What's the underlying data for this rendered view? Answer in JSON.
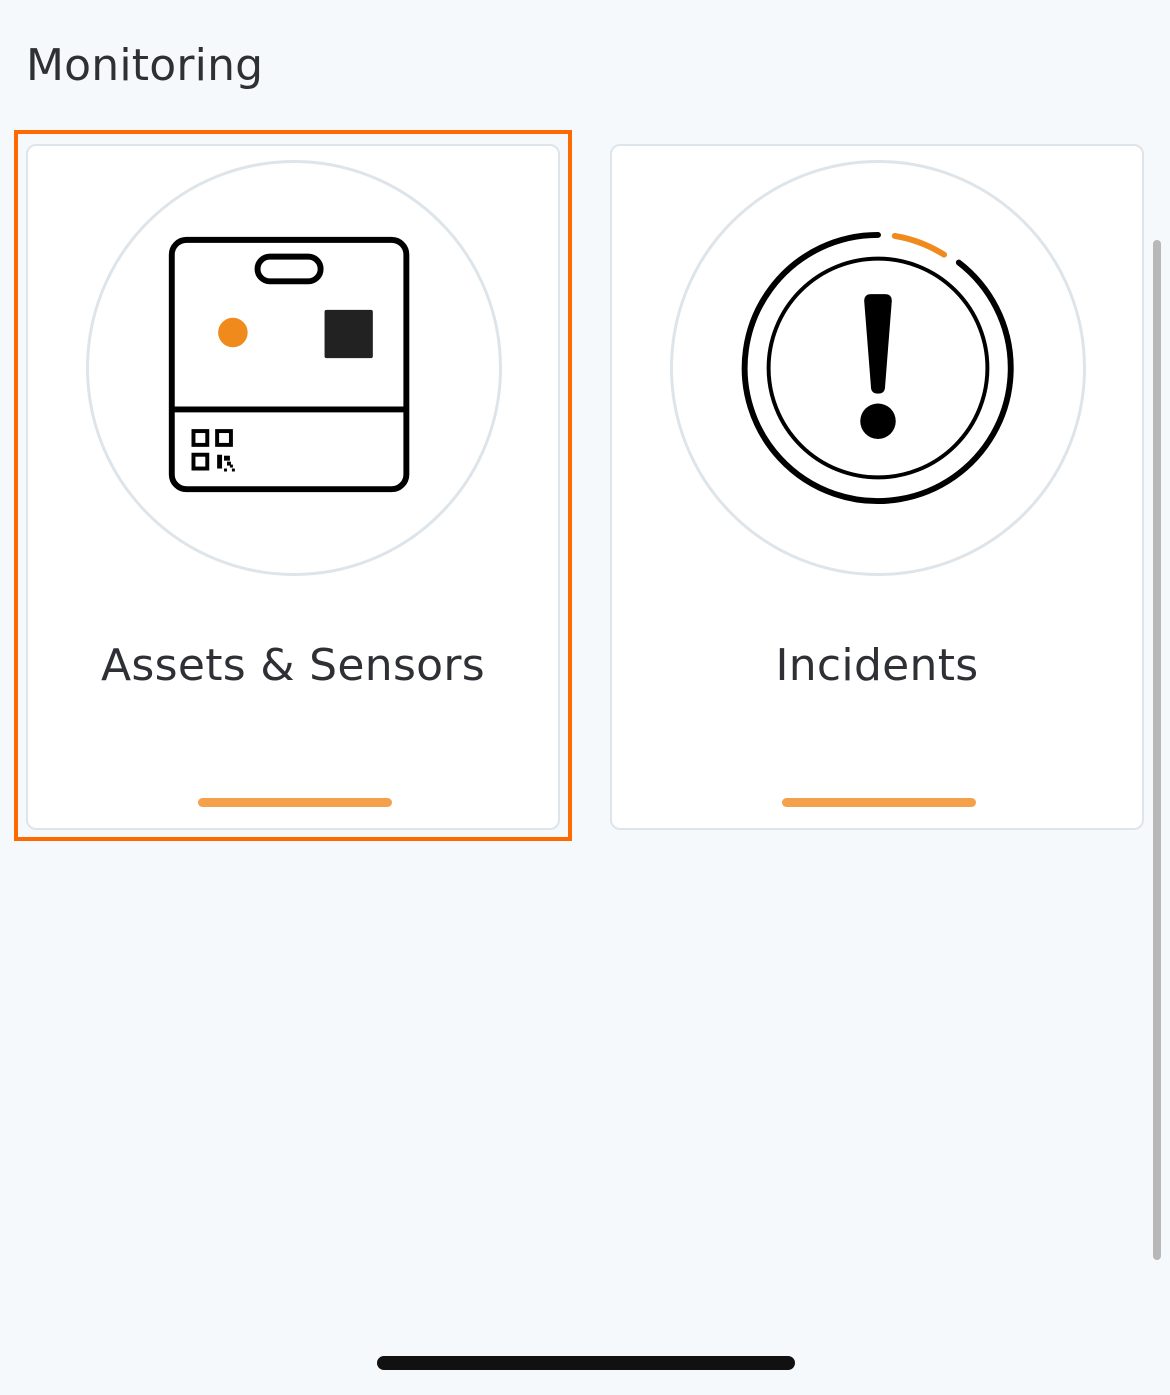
{
  "page": {
    "section_title": "Monitoring"
  },
  "tiles": [
    {
      "label": "Assets & Sensors",
      "icon": "asset-sensor-icon",
      "selected": true
    },
    {
      "label": "Incidents",
      "icon": "incident-alert-icon",
      "selected": false
    }
  ],
  "colors": {
    "background": "#f6f9fc",
    "tile_background": "#ffffff",
    "selection_outline": "#ff6a00",
    "accent_bar": "#f5a04b",
    "icon_accent": "#f08a1c",
    "text": "#2f3035"
  }
}
